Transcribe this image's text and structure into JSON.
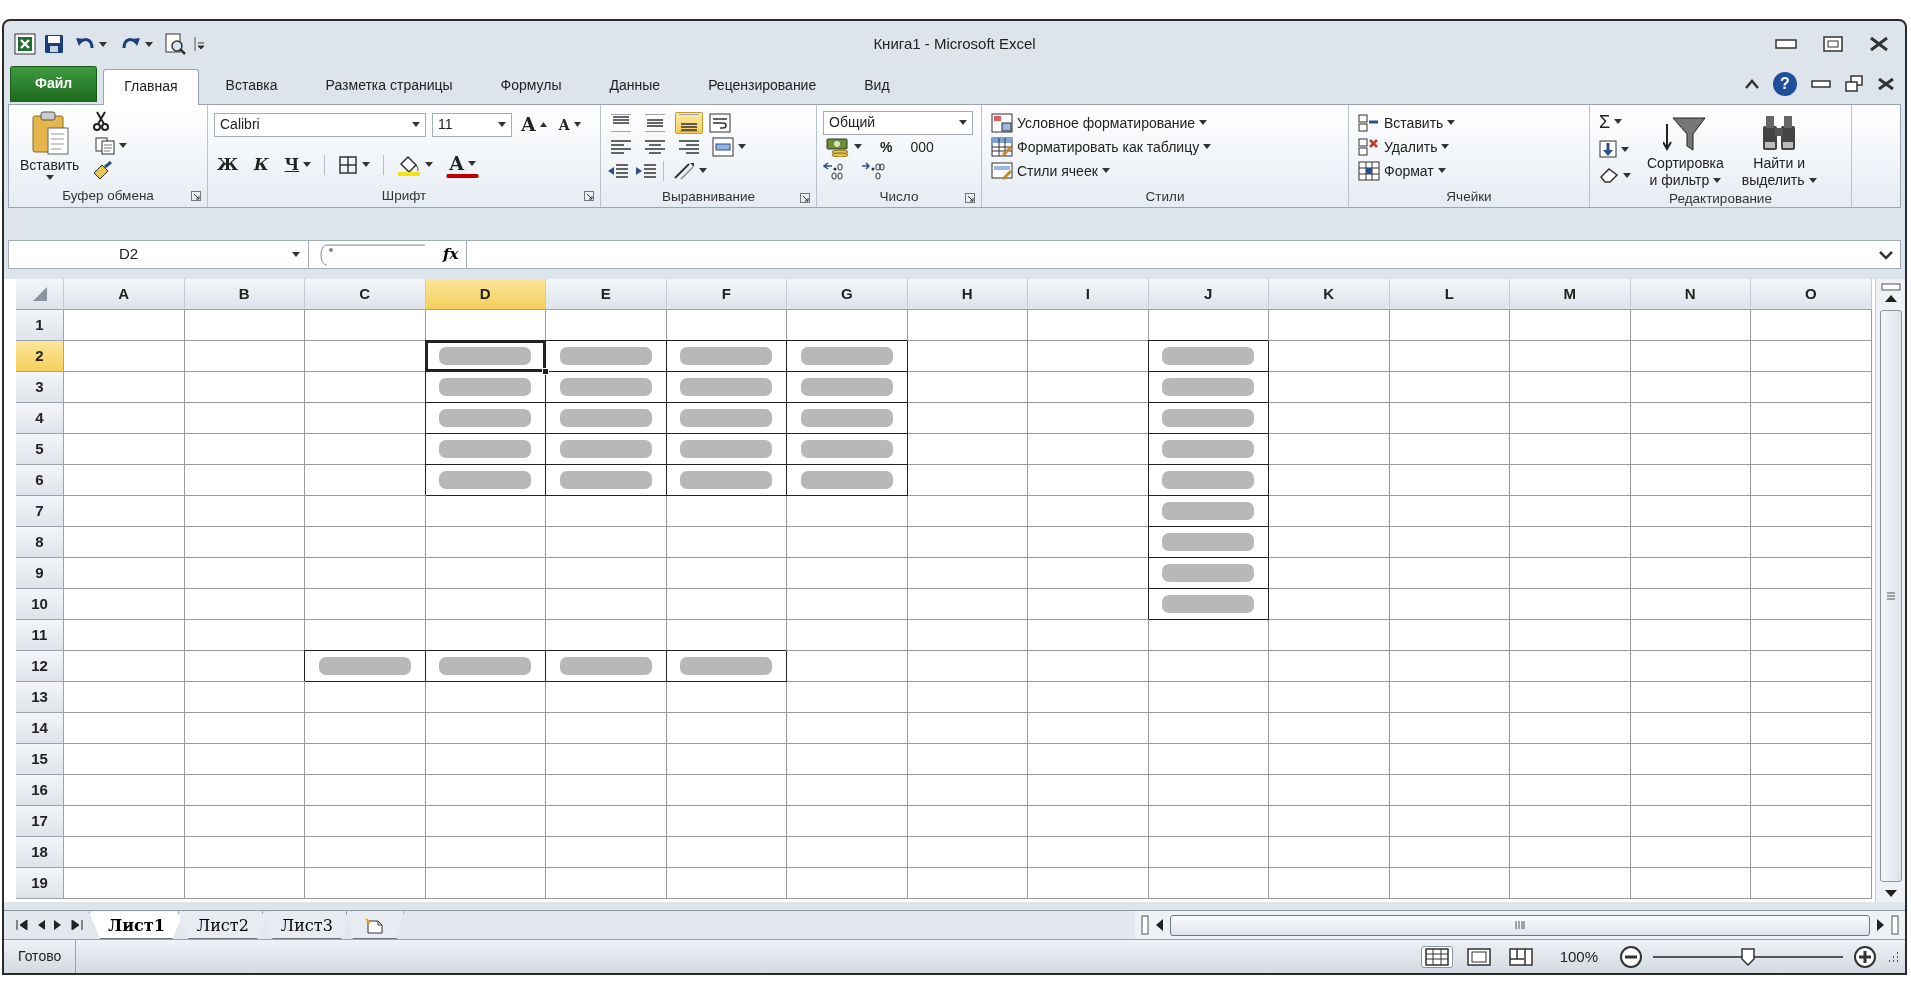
{
  "window": {
    "title": "Книга1 - Microsoft Excel"
  },
  "tabs": [
    {
      "label": "Файл",
      "kind": "file",
      "selected": false
    },
    {
      "label": "Главная",
      "kind": "tab",
      "selected": true
    },
    {
      "label": "Вставка",
      "kind": "tab",
      "selected": false
    },
    {
      "label": "Разметка страницы",
      "kind": "tab",
      "selected": false
    },
    {
      "label": "Формулы",
      "kind": "tab",
      "selected": false
    },
    {
      "label": "Данные",
      "kind": "tab",
      "selected": false
    },
    {
      "label": "Рецензирование",
      "kind": "tab",
      "selected": false
    },
    {
      "label": "Вид",
      "kind": "tab",
      "selected": false
    }
  ],
  "help": {
    "glyph": "?"
  },
  "ribbon": {
    "groups": [
      {
        "kind": "clipboard",
        "label": "Буфер обмена",
        "launcher": true,
        "paste": "Вставить"
      },
      {
        "kind": "font",
        "label": "Шрифт",
        "launcher": true,
        "font_name": "Calibri",
        "font_size": "11",
        "grow": "A",
        "shrink": "A",
        "styles": [
          "Ж",
          "К",
          "Ч"
        ],
        "font_color": "A"
      },
      {
        "kind": "alignment",
        "label": "Выравнивание",
        "launcher": true,
        "vertical_align": [
          {
            "kind": "top",
            "selected": false
          },
          {
            "kind": "middle",
            "selected": false
          },
          {
            "kind": "bottom",
            "selected": true
          }
        ]
      },
      {
        "kind": "number",
        "label": "Число",
        "launcher": true,
        "format": "Общий",
        "percent": "%",
        "thousands": "000"
      },
      {
        "kind": "styles",
        "label": "Стили",
        "launcher": false,
        "items": [
          {
            "kind": "conditional",
            "label": "Условное форматирование"
          },
          {
            "kind": "table",
            "label": "Форматировать как таблицу"
          },
          {
            "kind": "cell_styles",
            "label": "Стили ячеек"
          }
        ]
      },
      {
        "kind": "cells",
        "label": "Ячейки",
        "launcher": false,
        "items": [
          {
            "kind": "insert",
            "label": "Вставить"
          },
          {
            "kind": "delete",
            "label": "Удалить"
          },
          {
            "kind": "format",
            "label": "Формат"
          }
        ]
      },
      {
        "kind": "editing",
        "label": "Редактирование",
        "launcher": false,
        "sum": "Σ",
        "sort": [
          "Сортировка",
          "и фильтр"
        ],
        "find": [
          "Найти и",
          "выделить"
        ]
      }
    ]
  },
  "formula_bar": {
    "name_box": "D2",
    "function_glyph": "fx"
  },
  "sheet": {
    "columns": [
      {
        "label": "A",
        "selected": false
      },
      {
        "label": "B",
        "selected": false
      },
      {
        "label": "C",
        "selected": false
      },
      {
        "label": "D",
        "selected": true
      },
      {
        "label": "E",
        "selected": false
      },
      {
        "label": "F",
        "selected": false
      },
      {
        "label": "G",
        "selected": false
      },
      {
        "label": "H",
        "selected": false
      },
      {
        "label": "I",
        "selected": false
      },
      {
        "label": "J",
        "selected": false
      },
      {
        "label": "K",
        "selected": false
      },
      {
        "label": "L",
        "selected": false
      },
      {
        "label": "M",
        "selected": false
      },
      {
        "label": "N",
        "selected": false
      },
      {
        "label": "O",
        "selected": false
      }
    ],
    "rows": [
      {
        "label": "1",
        "selected": false,
        "filled": [
          false,
          false,
          false,
          false,
          false,
          false,
          false,
          false,
          false,
          false,
          false,
          false,
          false,
          false,
          false
        ]
      },
      {
        "label": "2",
        "selected": true,
        "filled": [
          false,
          false,
          false,
          true,
          true,
          true,
          true,
          false,
          false,
          true,
          false,
          false,
          false,
          false,
          false
        ]
      },
      {
        "label": "3",
        "selected": false,
        "filled": [
          false,
          false,
          false,
          true,
          true,
          true,
          true,
          false,
          false,
          true,
          false,
          false,
          false,
          false,
          false
        ]
      },
      {
        "label": "4",
        "selected": false,
        "filled": [
          false,
          false,
          false,
          true,
          true,
          true,
          true,
          false,
          false,
          true,
          false,
          false,
          false,
          false,
          false
        ]
      },
      {
        "label": "5",
        "selected": false,
        "filled": [
          false,
          false,
          false,
          true,
          true,
          true,
          true,
          false,
          false,
          true,
          false,
          false,
          false,
          false,
          false
        ]
      },
      {
        "label": "6",
        "selected": false,
        "filled": [
          false,
          false,
          false,
          true,
          true,
          true,
          true,
          false,
          false,
          true,
          false,
          false,
          false,
          false,
          false
        ]
      },
      {
        "label": "7",
        "selected": false,
        "filled": [
          false,
          false,
          false,
          false,
          false,
          false,
          false,
          false,
          false,
          true,
          false,
          false,
          false,
          false,
          false
        ]
      },
      {
        "label": "8",
        "selected": false,
        "filled": [
          false,
          false,
          false,
          false,
          false,
          false,
          false,
          false,
          false,
          true,
          false,
          false,
          false,
          false,
          false
        ]
      },
      {
        "label": "9",
        "selected": false,
        "filled": [
          false,
          false,
          false,
          false,
          false,
          false,
          false,
          false,
          false,
          true,
          false,
          false,
          false,
          false,
          false
        ]
      },
      {
        "label": "10",
        "selected": false,
        "filled": [
          false,
          false,
          false,
          false,
          false,
          false,
          false,
          false,
          false,
          true,
          false,
          false,
          false,
          false,
          false
        ]
      },
      {
        "label": "11",
        "selected": false,
        "filled": [
          false,
          false,
          false,
          false,
          false,
          false,
          false,
          false,
          false,
          false,
          false,
          false,
          false,
          false,
          false
        ]
      },
      {
        "label": "12",
        "selected": false,
        "filled": [
          false,
          false,
          true,
          true,
          true,
          true,
          false,
          false,
          false,
          false,
          false,
          false,
          false,
          false,
          false
        ]
      },
      {
        "label": "13",
        "selected": false,
        "filled": [
          false,
          false,
          false,
          false,
          false,
          false,
          false,
          false,
          false,
          false,
          false,
          false,
          false,
          false,
          false
        ]
      },
      {
        "label": "14",
        "selected": false,
        "filled": [
          false,
          false,
          false,
          false,
          false,
          false,
          false,
          false,
          false,
          false,
          false,
          false,
          false,
          false,
          false
        ]
      },
      {
        "label": "15",
        "selected": false,
        "filled": [
          false,
          false,
          false,
          false,
          false,
          false,
          false,
          false,
          false,
          false,
          false,
          false,
          false,
          false,
          false
        ]
      },
      {
        "label": "16",
        "selected": false,
        "filled": [
          false,
          false,
          false,
          false,
          false,
          false,
          false,
          false,
          false,
          false,
          false,
          false,
          false,
          false,
          false
        ]
      },
      {
        "label": "17",
        "selected": false,
        "filled": [
          false,
          false,
          false,
          false,
          false,
          false,
          false,
          false,
          false,
          false,
          false,
          false,
          false,
          false,
          false
        ]
      },
      {
        "label": "18",
        "selected": false,
        "filled": [
          false,
          false,
          false,
          false,
          false,
          false,
          false,
          false,
          false,
          false,
          false,
          false,
          false,
          false,
          false
        ]
      },
      {
        "label": "19",
        "selected": false,
        "filled": [
          false,
          false,
          false,
          false,
          false,
          false,
          false,
          false,
          false,
          false,
          false,
          false,
          false,
          false,
          false
        ]
      }
    ]
  },
  "sheet_tabs": [
    {
      "label": "Лист1",
      "selected": true
    },
    {
      "label": "Лист2",
      "selected": false
    },
    {
      "label": "Лист3",
      "selected": false
    }
  ],
  "status_bar": {
    "text": "Готово",
    "views": [
      {
        "kind": "normal",
        "selected": true
      },
      {
        "kind": "page_layout",
        "selected": false
      },
      {
        "kind": "page_break",
        "selected": false
      }
    ],
    "zoom": "100%",
    "zoom_slider": {
      "level": 0.5
    }
  }
}
